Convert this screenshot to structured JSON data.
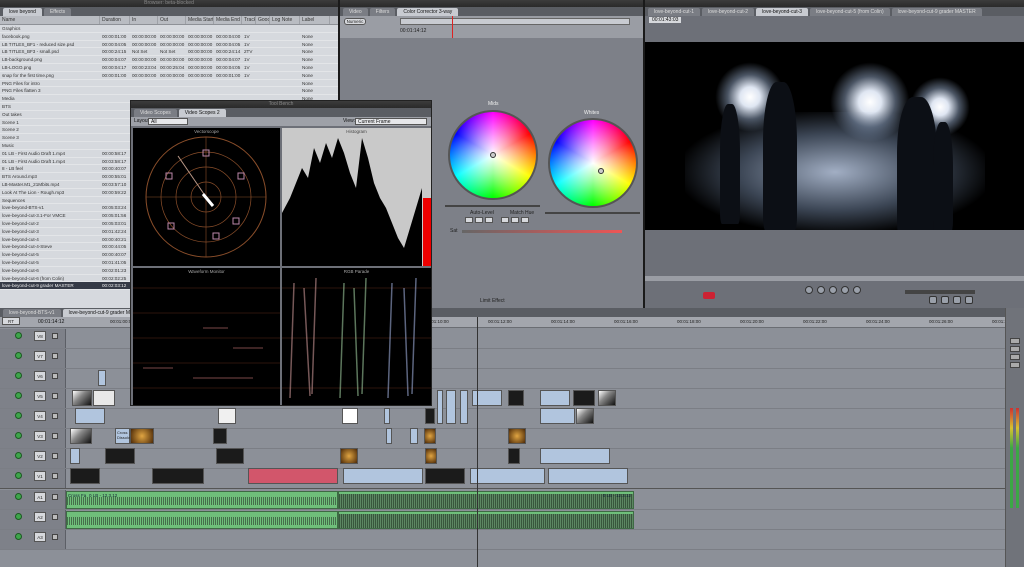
{
  "browser": {
    "window_title": "Browser: beta-blocked",
    "tabs": [
      {
        "label": "love beyond"
      },
      {
        "label": "Effects"
      }
    ],
    "columns": [
      "Name",
      "Duration",
      "In",
      "Out",
      "Media Start",
      "Media End",
      "Tracks",
      "Good",
      "Log Note",
      "Label"
    ],
    "rows": [
      {
        "name": "Graphics",
        "duration": "",
        "in": "",
        "out": "",
        "mstart": "",
        "mend": "",
        "tracks": "",
        "label": ""
      },
      {
        "name": "facebook.png",
        "duration": "00:00:01:00",
        "in": "00:00:00:00",
        "out": "00:00:00:00",
        "mstart": "00:00:00:00",
        "mend": "00:00:04:00",
        "tracks": "1V",
        "label": "None"
      },
      {
        "name": "LB TITLES_BF1 - reduced size.psd",
        "duration": "00:00:04:05",
        "in": "00:00:00:00",
        "out": "00:00:00:00",
        "mstart": "00:00:00:00",
        "mend": "00:00:04:05",
        "tracks": "1V",
        "label": "None"
      },
      {
        "name": "LB TITLES_BF3 - small.psd",
        "duration": "00:00:24:15",
        "in": "Not Set",
        "out": "Not Set",
        "mstart": "00:00:00:00",
        "mend": "00:00:24:14",
        "tracks": "2TV",
        "label": "None"
      },
      {
        "name": "LB-background.png",
        "duration": "00:00:04:07",
        "in": "00:00:00:00",
        "out": "00:00:00:00",
        "mstart": "00:00:00:00",
        "mend": "00:00:04:07",
        "tracks": "1V",
        "label": "None"
      },
      {
        "name": "LB-LOGO.png",
        "duration": "00:00:04:17",
        "in": "00:00:23:04",
        "out": "00:00:25:04",
        "mstart": "00:00:00:00",
        "mend": "00:00:04:05",
        "tracks": "1V",
        "label": "None"
      },
      {
        "name": "snap for the first time.png",
        "duration": "00:00:01:00",
        "in": "00:00:00:00",
        "out": "00:00:00:00",
        "mstart": "00:00:00:00",
        "mend": "00:00:01:00",
        "tracks": "1V",
        "label": "None"
      },
      {
        "name": "PNG Files for intro",
        "duration": "",
        "in": "",
        "out": "",
        "mstart": "",
        "mend": "",
        "tracks": "",
        "label": "None"
      },
      {
        "name": "PNG Files flatten 3",
        "duration": "",
        "in": "",
        "out": "",
        "mstart": "",
        "mend": "",
        "tracks": "",
        "label": "None"
      },
      {
        "name": "Media",
        "duration": "",
        "in": "",
        "out": "",
        "mstart": "",
        "mend": "",
        "tracks": "",
        "label": "None"
      },
      {
        "name": "BTS",
        "duration": "",
        "in": "",
        "out": "",
        "mstart": "",
        "mend": "",
        "tracks": "",
        "label": "None"
      },
      {
        "name": "Out takes",
        "duration": "",
        "in": "",
        "out": "",
        "mstart": "",
        "mend": "",
        "tracks": "",
        "label": "None"
      },
      {
        "name": "Scene 1",
        "duration": "",
        "in": "",
        "out": "",
        "mstart": "",
        "mend": "",
        "tracks": "",
        "label": "None"
      },
      {
        "name": "Scene 2",
        "duration": "",
        "in": "",
        "out": "",
        "mstart": "",
        "mend": "",
        "tracks": "",
        "label": "None"
      },
      {
        "name": "Scene 3",
        "duration": "",
        "in": "",
        "out": "",
        "mstart": "",
        "mend": "",
        "tracks": "",
        "label": "None"
      },
      {
        "name": "Music",
        "duration": "",
        "in": "",
        "out": "",
        "mstart": "",
        "mend": "",
        "tracks": "",
        "label": "None"
      },
      {
        "name": "01 LB - First Audio Draft 1.mp4",
        "duration": "00:00:58:17",
        "in": "",
        "out": "",
        "mstart": "",
        "mend": "",
        "tracks": "",
        "label": "None"
      },
      {
        "name": "01 LB - First Audio Draft 1.mp4",
        "duration": "00:03:58:17",
        "in": "",
        "out": "",
        "mstart": "",
        "mend": "",
        "tracks": "",
        "label": "None"
      },
      {
        "name": "8 - LB feel",
        "duration": "00:00:40:07",
        "in": "",
        "out": "",
        "mstart": "",
        "mend": "",
        "tracks": "",
        "label": "None"
      },
      {
        "name": "BTS Around.mp3",
        "duration": "00:00:55:01",
        "in": "",
        "out": "",
        "mstart": "",
        "mend": "",
        "tracks": "",
        "label": "None"
      },
      {
        "name": "LB-Master.M1_21Mbits.mp4",
        "duration": "00:03:57:10",
        "in": "",
        "out": "",
        "mstart": "",
        "mend": "",
        "tracks": "",
        "label": "None"
      },
      {
        "name": "Look At The Lion - Rough.mp3",
        "duration": "00:00:59:22",
        "in": "",
        "out": "",
        "mstart": "",
        "mend": "",
        "tracks": "",
        "label": "None"
      },
      {
        "name": "Sequences",
        "duration": "",
        "in": "",
        "out": "",
        "mstart": "",
        "mend": "",
        "tracks": "",
        "label": "None"
      },
      {
        "name": "love-beyond-BTS-v1",
        "duration": "00:05:03:24",
        "in": "",
        "out": "",
        "mstart": "",
        "mend": "",
        "tracks": "",
        "label": "None"
      },
      {
        "name": "love-beyond-cut-3.1-For VMCE",
        "duration": "00:05:01:56",
        "in": "",
        "out": "",
        "mstart": "",
        "mend": "",
        "tracks": "",
        "label": "None"
      },
      {
        "name": "love-beyond-cut-2",
        "duration": "00:05:03:01",
        "in": "",
        "out": "",
        "mstart": "",
        "mend": "",
        "tracks": "",
        "label": "None"
      },
      {
        "name": "love-beyond-cut-3",
        "duration": "00:01:42:24",
        "in": "",
        "out": "",
        "mstart": "",
        "mend": "",
        "tracks": "",
        "label": "None"
      },
      {
        "name": "love-beyond-cut-4",
        "duration": "00:00:40:21",
        "in": "",
        "out": "",
        "mstart": "",
        "mend": "",
        "tracks": "",
        "label": "None"
      },
      {
        "name": "love-beyond-cut-4-Steve",
        "duration": "00:00:44:05",
        "in": "",
        "out": "",
        "mstart": "",
        "mend": "",
        "tracks": "",
        "label": "None"
      },
      {
        "name": "love-beyond-cut-5",
        "duration": "00:00:40:07",
        "in": "",
        "out": "",
        "mstart": "",
        "mend": "",
        "tracks": "",
        "label": "None"
      },
      {
        "name": "love-beyond-cut-5",
        "duration": "00:01:41:05",
        "in": "",
        "out": "",
        "mstart": "",
        "mend": "",
        "tracks": "",
        "label": "None"
      },
      {
        "name": "love-beyond-cut-6",
        "duration": "00:02:01:23",
        "in": "",
        "out": "",
        "mstart": "",
        "mend": "",
        "tracks": "",
        "label": "None"
      },
      {
        "name": "love-beyond-cut-6 (from Colin)",
        "duration": "00:02:02:25",
        "in": "",
        "out": "",
        "mstart": "",
        "mend": "",
        "tracks": "",
        "label": "None"
      },
      {
        "name": "love-beyond-cut-9 grader MASTER",
        "duration": "00:02:03:12",
        "in": "",
        "out": "",
        "mstart": "",
        "mend": "",
        "tracks": "",
        "label": "None",
        "selected": true
      }
    ]
  },
  "color_corrector": {
    "tabs": [
      {
        "label": "Video"
      },
      {
        "label": "Filters"
      },
      {
        "label": "Color Corrector 3-way"
      }
    ],
    "numeric_button": "Numeric",
    "timecode": "00:01:14:12",
    "wheels": [
      {
        "label": "Mids"
      },
      {
        "label": "Whites"
      }
    ],
    "auto_level_label": "Auto-Level",
    "match_hue_label": "Match Hue",
    "sat_label": "Sat",
    "limit_effect_label": "Limit Effect"
  },
  "viewer": {
    "tabs": [
      {
        "label": "love-beyond-cut-1"
      },
      {
        "label": "love-beyond-cut-2"
      },
      {
        "label": "love-beyond-cut-3"
      },
      {
        "label": "love-beyond-cut-5 (from Colin)"
      },
      {
        "label": "love-beyond-cut-9 grader MASTER"
      }
    ],
    "timecode": "00:01:43:03"
  },
  "tool_bench": {
    "title": "Tool Bench",
    "tabs": [
      {
        "label": "Video Scopes"
      },
      {
        "label": "Video Scopes 2"
      }
    ],
    "layout_label": "Layout:",
    "layout_value": "All",
    "view_label": "View:",
    "view_value": "Current Frame",
    "scopes": [
      "Vectorscope",
      "Histogram",
      "Waveform Monitor",
      "RGB Parade"
    ]
  },
  "timeline": {
    "tabs": [
      {
        "label": "love-beyond-BTS-v1"
      },
      {
        "label": "love-beyond-cut-9 grader MASTER"
      }
    ],
    "timecode": "00:01:14:12",
    "rt_label": "RT",
    "ruler_ticks": [
      "00:01:00:00",
      "00:01:02:00",
      "00:01:04:00",
      "00:01:06:00",
      "00:01:08:00",
      "00:01:10:00",
      "00:01:12:00",
      "00:01:14:00",
      "00:01:16:00",
      "00:01:18:00",
      "00:01:20:00",
      "00:01:22:00",
      "00:01:24:00",
      "00:01:26:00",
      "00:01:28:00"
    ],
    "video_tracks": [
      {
        "name": "V8"
      },
      {
        "name": "V7"
      },
      {
        "name": "V6"
      },
      {
        "name": "V5"
      },
      {
        "name": "V4"
      },
      {
        "name": "V3"
      },
      {
        "name": "V2"
      },
      {
        "name": "V1"
      }
    ],
    "audio_tracks": [
      {
        "name": "A1"
      },
      {
        "name": "A2"
      },
      {
        "name": "A3"
      }
    ],
    "audio_clip_labels": [
      "Cross Fa",
      "0 LB - 12.3.12",
      "0 LB - 12.3.12"
    ],
    "clip_labels": [
      "Cross Dissolve",
      "Cross Dissolve"
    ]
  },
  "colors": {
    "accent": "#3da54a",
    "audio_clip": "#6fbf7a",
    "video_clip": "#b1c5de",
    "panel_bg": "#7d8088"
  }
}
